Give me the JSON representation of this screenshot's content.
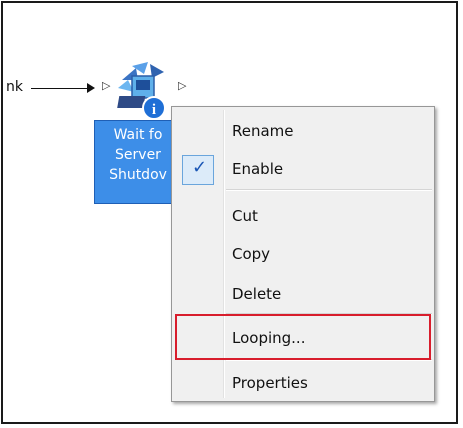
{
  "workflow": {
    "link_label": "nk",
    "activity_label_lines": [
      "Wait fo",
      "Server",
      "Shutdov"
    ],
    "icon": "server-shutdown-activity-icon"
  },
  "context_menu": {
    "items": [
      {
        "label": "Rename",
        "checked": false
      },
      {
        "label": "Enable",
        "checked": true
      },
      {
        "label": "Cut",
        "checked": false
      },
      {
        "label": "Copy",
        "checked": false
      },
      {
        "label": "Delete",
        "checked": false
      },
      {
        "label": "Looping...",
        "checked": false,
        "highlighted": true
      },
      {
        "label": "Properties",
        "checked": false
      }
    ],
    "check_glyph": "✓"
  },
  "colors": {
    "selection_blue": "#3d8ee8",
    "menu_background": "#f0f0f0",
    "highlight_red": "#d81d2c"
  }
}
